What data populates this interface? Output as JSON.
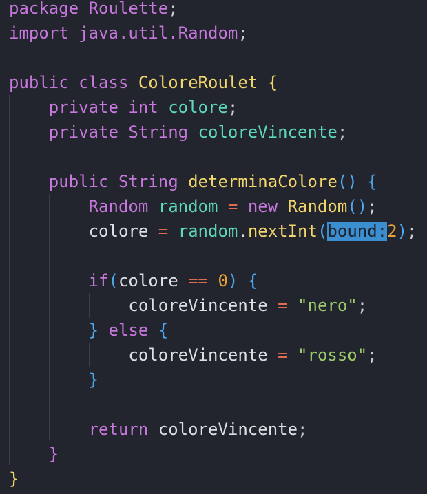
{
  "editor": {
    "language": "java",
    "colors": {
      "background": "#22252d",
      "keyword": "#c678dd",
      "class": "#f3d76c",
      "field": "#5fd7bd",
      "operator": "#e06c4f",
      "number": "#e8a23a",
      "brace": "#4ea8f0",
      "string": "#9ccc6c",
      "hint_highlight": "#3b8fd0"
    },
    "lines": [
      [
        [
          "kw",
          "package "
        ],
        [
          "kw",
          "Roulette"
        ],
        [
          "punc",
          ";"
        ]
      ],
      [
        [
          "kw",
          "import "
        ],
        [
          "kw",
          "java.util.Random"
        ],
        [
          "punc",
          ";"
        ]
      ],
      [],
      [
        [
          "kw",
          "public "
        ],
        [
          "kw",
          "class "
        ],
        [
          "cls",
          "ColoreRoulet "
        ],
        [
          "cls",
          "{"
        ]
      ],
      [
        [
          "pl",
          "    "
        ],
        [
          "kw",
          "private "
        ],
        [
          "kw",
          "int "
        ],
        [
          "fld",
          "colore"
        ],
        [
          "punc",
          ";"
        ]
      ],
      [
        [
          "pl",
          "    "
        ],
        [
          "kw",
          "private "
        ],
        [
          "kw",
          "String "
        ],
        [
          "fld",
          "coloreVincente"
        ],
        [
          "punc",
          ";"
        ]
      ],
      [],
      [
        [
          "pl",
          "    "
        ],
        [
          "kw",
          "public "
        ],
        [
          "kw",
          "String "
        ],
        [
          "fn",
          "determinaColore"
        ],
        [
          "br",
          "() {"
        ]
      ],
      [
        [
          "pl",
          "        "
        ],
        [
          "kw",
          "Random "
        ],
        [
          "fld",
          "random "
        ],
        [
          "op",
          "= "
        ],
        [
          "kw",
          "new "
        ],
        [
          "fn",
          "Random"
        ],
        [
          "br",
          "()"
        ],
        [
          "punc",
          ";"
        ]
      ],
      [
        [
          "pl",
          "        colore "
        ],
        [
          "op",
          "= "
        ],
        [
          "fld",
          "random"
        ],
        [
          "pl",
          "."
        ],
        [
          "fn",
          "nextInt"
        ],
        [
          "br",
          "("
        ],
        [
          "hint",
          "bound:"
        ],
        [
          "num",
          "2"
        ],
        [
          "br",
          ")"
        ],
        [
          "punc",
          ";"
        ]
      ],
      [],
      [
        [
          "pl",
          "        "
        ],
        [
          "kw",
          "if"
        ],
        [
          "br",
          "("
        ],
        [
          "pl",
          "colore "
        ],
        [
          "op",
          "== "
        ],
        [
          "num",
          "0"
        ],
        [
          "br",
          ") {"
        ]
      ],
      [
        [
          "pl",
          "            coloreVincente "
        ],
        [
          "op",
          "= "
        ],
        [
          "str",
          "\"nero\""
        ],
        [
          "punc",
          ";"
        ]
      ],
      [
        [
          "pl",
          "        "
        ],
        [
          "br",
          "} "
        ],
        [
          "kw",
          "else "
        ],
        [
          "br",
          "{"
        ]
      ],
      [
        [
          "pl",
          "            coloreVincente "
        ],
        [
          "op",
          "= "
        ],
        [
          "str",
          "\"rosso\""
        ],
        [
          "punc",
          ";"
        ]
      ],
      [
        [
          "pl",
          "        "
        ],
        [
          "br",
          "}"
        ]
      ],
      [],
      [
        [
          "pl",
          "        "
        ],
        [
          "kw",
          "return "
        ],
        [
          "pl",
          "coloreVincente"
        ],
        [
          "punc",
          ";"
        ]
      ],
      [
        [
          "pl",
          "    "
        ],
        [
          "kw",
          "}"
        ]
      ],
      [
        [
          "cls",
          "}"
        ]
      ]
    ]
  }
}
